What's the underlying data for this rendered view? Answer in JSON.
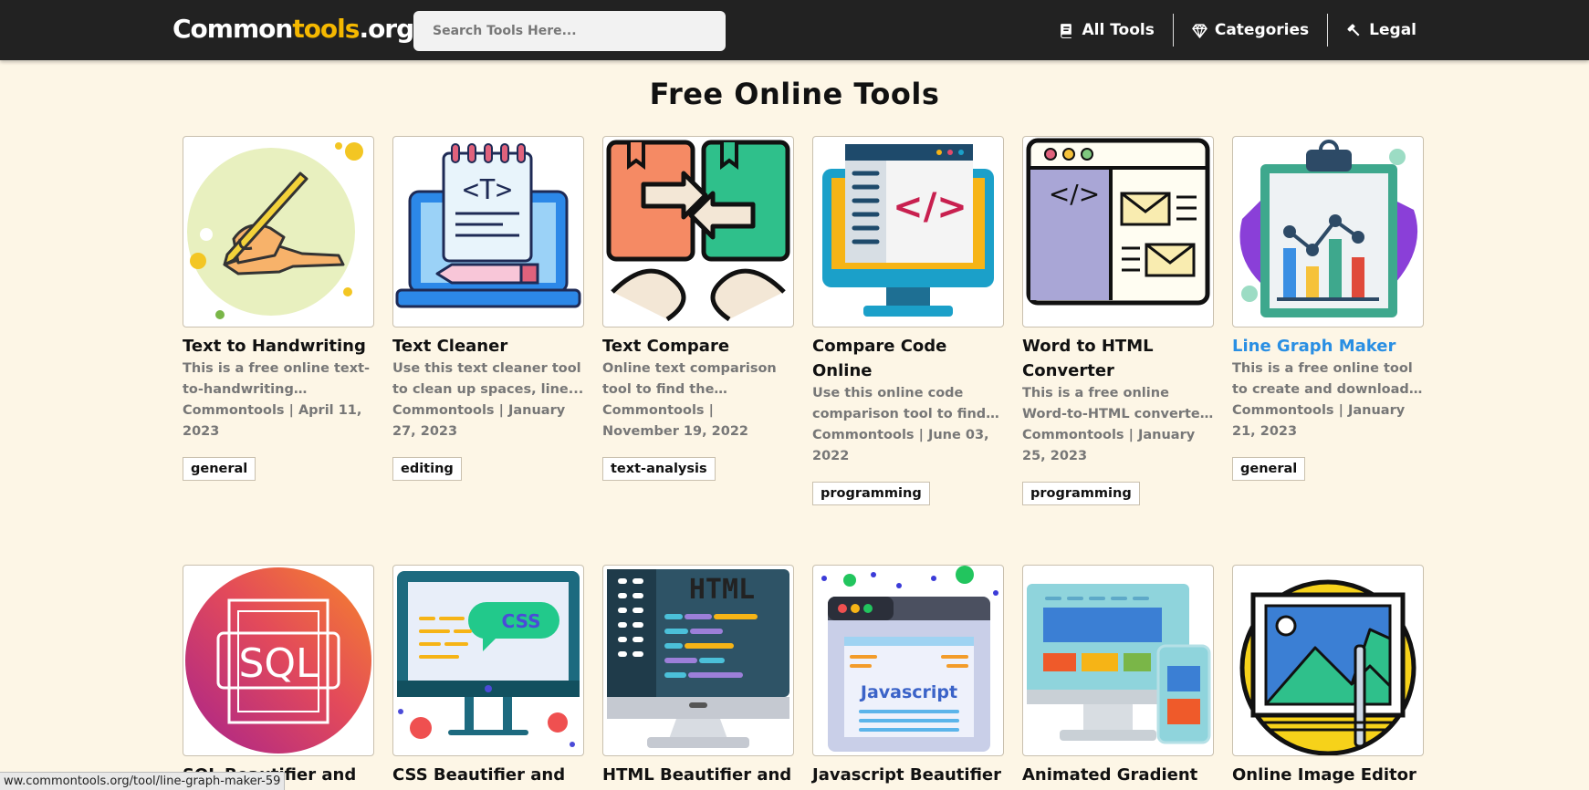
{
  "logo": {
    "part1": "Common",
    "part2": "tools",
    "part3": ".org"
  },
  "search": {
    "placeholder": "Search Tools Here..."
  },
  "nav": [
    {
      "label": "All Tools",
      "icon": "book-icon"
    },
    {
      "label": "Categories",
      "icon": "diamond-icon"
    },
    {
      "label": "Legal",
      "icon": "gavel-icon"
    }
  ],
  "page_title": "Free Online Tools",
  "cards": [
    {
      "title": "Text to Handwriting",
      "desc": "This is a free online text-to-handwriting converter...",
      "meta": "Commontools | April 11, 2023",
      "tag": "general",
      "icon": "handwriting-icon"
    },
    {
      "title": "Text Cleaner",
      "desc": "Use this text cleaner tool to clean up spaces, line...",
      "meta": "Commontools | January 27, 2023",
      "tag": "editing",
      "icon": "text-cleaner-icon"
    },
    {
      "title": "Text Compare",
      "desc": "Online text comparison tool to find the difference...",
      "meta": "Commontools | November 19, 2022",
      "tag": "text-analysis",
      "icon": "text-compare-icon"
    },
    {
      "title": "Compare Code Online",
      "desc": "Use this online code comparison tool to find th...",
      "meta": "Commontools | June 03, 2022",
      "tag": "programming",
      "icon": "code-compare-icon"
    },
    {
      "title": "Word to HTML Converter",
      "desc": "This is a free online Word-to-HTML converter tool....",
      "meta": "Commontools | January 25, 2023",
      "tag": "programming",
      "icon": "word-to-html-icon"
    },
    {
      "title": "Line Graph Maker",
      "desc": "This is a free online tool to create and download line...",
      "meta": "Commontools | January 21, 2023",
      "tag": "general",
      "icon": "line-graph-icon"
    },
    {
      "title": "SQL Beautifier and",
      "icon": "sql-icon"
    },
    {
      "title": "CSS Beautifier and",
      "icon": "css-icon"
    },
    {
      "title": "HTML Beautifier and",
      "icon": "html-icon"
    },
    {
      "title": "Javascript Beautifier",
      "icon": "javascript-icon"
    },
    {
      "title": "Animated Gradient",
      "icon": "gradient-icon"
    },
    {
      "title": "Online Image Editor",
      "icon": "image-editor-icon"
    }
  ],
  "icon_text": {
    "sql": "SQL",
    "css": "CSS",
    "html": "HTML",
    "js": "Javascript",
    "tcode": "</>",
    "wcode": "</>",
    "tletter": "<T>"
  },
  "status_url": "ww.commontools.org/tool/line-graph-maker-59",
  "colors": {
    "header_bg": "#222222",
    "page_bg": "#fdf6e6",
    "logo_accent": "#f5b800",
    "link_active": "#2a8fe3"
  }
}
